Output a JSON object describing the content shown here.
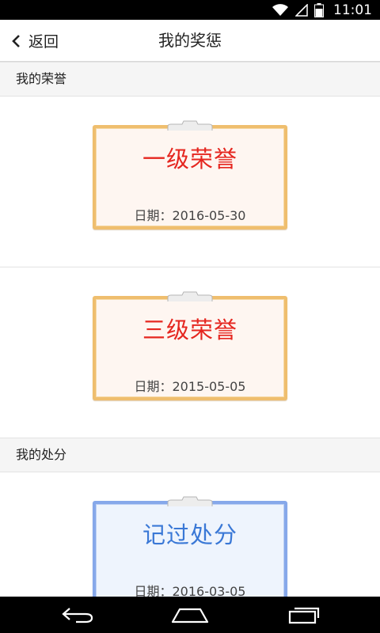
{
  "status_bar": {
    "time": "11:01"
  },
  "header": {
    "back_label": "返回",
    "title": "我的奖惩"
  },
  "sections": {
    "honors_title": "我的荣誉",
    "punishments_title": "我的处分"
  },
  "honors": [
    {
      "title": "一级荣誉",
      "date": "日期：2016-05-30"
    },
    {
      "title": "三级荣誉",
      "date": "日期：2015-05-05"
    }
  ],
  "punishments": [
    {
      "title": "记过处分",
      "date": "日期：2016-03-05"
    }
  ],
  "colors": {
    "honor_title": "#e5261f",
    "honor_border": "#efbe6e",
    "punish_title": "#3a78d6",
    "punish_border": "#86a8ea"
  },
  "icons": {
    "status": [
      "wifi-icon",
      "signal-icon",
      "battery-icon"
    ],
    "nav": [
      "nav-back-icon",
      "nav-home-icon",
      "nav-recents-icon"
    ],
    "header": "chevron-left-icon",
    "card_clip": "clip-icon"
  }
}
